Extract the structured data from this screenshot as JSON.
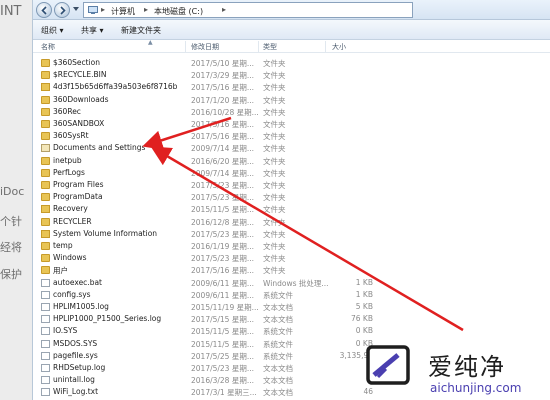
{
  "background": {
    "fragments": [
      "INT",
      "iDoc",
      "个针",
      "经将",
      "保护"
    ]
  },
  "address": {
    "crumbs": [
      "计算机",
      "本地磁盘 (C:)"
    ]
  },
  "toolbar": {
    "organize": "组织 ▾",
    "share": "共享 ▾",
    "new_folder": "新建文件夹"
  },
  "columns": {
    "name": "名称",
    "date": "修改日期",
    "type": "类型",
    "size": "大小"
  },
  "files": [
    {
      "name": "$360Section",
      "date": "2017/5/10 星期...",
      "type": "文件夹",
      "size": "",
      "icon": "folder"
    },
    {
      "name": "$RECYCLE.BIN",
      "date": "2017/3/29 星期...",
      "type": "文件夹",
      "size": "",
      "icon": "folder"
    },
    {
      "name": "4d3f15b65d6ffa39a503e6f8716b",
      "date": "2017/5/16 星期...",
      "type": "文件夹",
      "size": "",
      "icon": "folder-lock"
    },
    {
      "name": "360Downloads",
      "date": "2017/1/20 星期...",
      "type": "文件夹",
      "size": "",
      "icon": "folder"
    },
    {
      "name": "360Rec",
      "date": "2016/10/28 星期...",
      "type": "文件夹",
      "size": "",
      "icon": "folder"
    },
    {
      "name": "360SANDBOX",
      "date": "2017/5/16 星期...",
      "type": "文件夹",
      "size": "",
      "icon": "folder"
    },
    {
      "name": "360SysRt",
      "date": "2017/5/16 星期...",
      "type": "文件夹",
      "size": "",
      "icon": "folder"
    },
    {
      "name": "Documents and Settings",
      "date": "2009/7/14 星期...",
      "type": "文件夹",
      "size": "",
      "icon": "shortcut"
    },
    {
      "name": "inetpub",
      "date": "2016/6/20 星期...",
      "type": "文件夹",
      "size": "",
      "icon": "folder"
    },
    {
      "name": "PerfLogs",
      "date": "2009/7/14 星期...",
      "type": "文件夹",
      "size": "",
      "icon": "folder"
    },
    {
      "name": "Program Files",
      "date": "2017/5/23 星期...",
      "type": "文件夹",
      "size": "",
      "icon": "folder"
    },
    {
      "name": "ProgramData",
      "date": "2017/5/23 星期...",
      "type": "文件夹",
      "size": "",
      "icon": "folder"
    },
    {
      "name": "Recovery",
      "date": "2015/11/5 星期...",
      "type": "文件夹",
      "size": "",
      "icon": "folder-lock"
    },
    {
      "name": "RECYCLER",
      "date": "2016/12/8 星期...",
      "type": "文件夹",
      "size": "",
      "icon": "folder"
    },
    {
      "name": "System Volume Information",
      "date": "2017/5/23 星期...",
      "type": "文件夹",
      "size": "",
      "icon": "folder-lock"
    },
    {
      "name": "temp",
      "date": "2016/1/19 星期...",
      "type": "文件夹",
      "size": "",
      "icon": "folder"
    },
    {
      "name": "Windows",
      "date": "2017/5/23 星期...",
      "type": "文件夹",
      "size": "",
      "icon": "folder"
    },
    {
      "name": "用户",
      "date": "2017/5/16 星期...",
      "type": "文件夹",
      "size": "",
      "icon": "folder"
    },
    {
      "name": "autoexec.bat",
      "date": "2009/6/11 星期...",
      "type": "Windows 批处理...",
      "size": "1 KB",
      "icon": "file"
    },
    {
      "name": "config.sys",
      "date": "2009/6/11 星期...",
      "type": "系统文件",
      "size": "1 KB",
      "icon": "file"
    },
    {
      "name": "HPLIM1005.log",
      "date": "2015/11/19 星期...",
      "type": "文本文档",
      "size": "5 KB",
      "icon": "file"
    },
    {
      "name": "HPLIP1000_P1500_Series.log",
      "date": "2017/5/15 星期...",
      "type": "文本文档",
      "size": "76 KB",
      "icon": "file"
    },
    {
      "name": "IO.SYS",
      "date": "2015/11/5 星期...",
      "type": "系统文件",
      "size": "0 KB",
      "icon": "file"
    },
    {
      "name": "MSDOS.SYS",
      "date": "2015/11/5 星期...",
      "type": "系统文件",
      "size": "0 KB",
      "icon": "file"
    },
    {
      "name": "pagefile.sys",
      "date": "2017/5/25 星期...",
      "type": "系统文件",
      "size": "3,135,94",
      "icon": "file"
    },
    {
      "name": "RHDSetup.log",
      "date": "2017/5/23 星期...",
      "type": "文本文档",
      "size": "3",
      "icon": "file"
    },
    {
      "name": "unintall.log",
      "date": "2016/3/28 星期...",
      "type": "文本文档",
      "size": "3",
      "icon": "file"
    },
    {
      "name": "WiFi_Log.txt",
      "date": "2017/3/1 星期三...",
      "type": "文本文档",
      "size": "46",
      "icon": "file"
    }
  ],
  "watermark": {
    "brand": "爱纯净",
    "url": "aichunjing.com"
  },
  "colors": {
    "arrow": "#e02020",
    "folder": "#e8c455"
  }
}
